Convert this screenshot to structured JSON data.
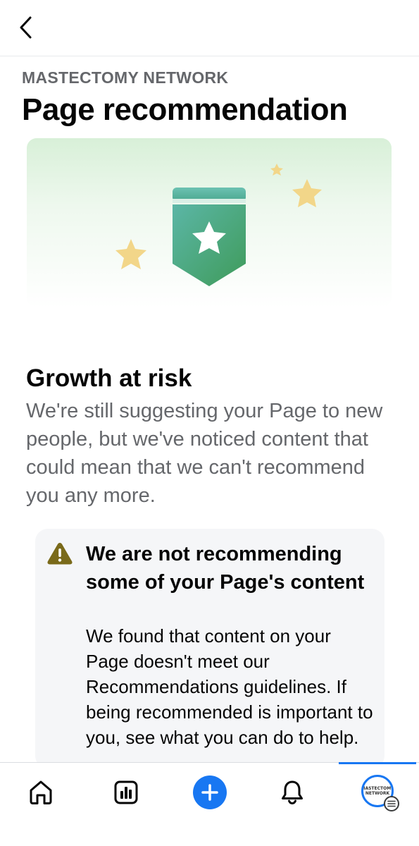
{
  "header": {
    "back_icon": "chevron-left-icon",
    "page_name": "MASTECTOMY NETWORK",
    "title": "Page recommendation"
  },
  "banner": {
    "icons": [
      "ribbon-star-icon",
      "star-icon",
      "star-icon",
      "star-icon"
    ],
    "colors": {
      "ribbon_top": "#5bb6a6",
      "ribbon_bottom": "#3f9b5a",
      "star": "#f2d689"
    }
  },
  "status": {
    "title": "Growth at risk",
    "description": "We're still suggesting your Page to new people, but we've noticed content that could mean that we can't recommend you any more."
  },
  "notice": {
    "icon": "warning-icon",
    "icon_color": "#7a6a1a",
    "title": "We are not recommending some of your Page's content",
    "body": "We found that content on your Page doesn't meet our Recommendations guidelines. If being recommended is important to you, see what you can do to help."
  },
  "tabbar": {
    "items": [
      {
        "icon": "home-icon"
      },
      {
        "icon": "insights-icon"
      },
      {
        "icon": "create-plus-icon"
      },
      {
        "icon": "bell-icon"
      },
      {
        "icon": "profile-menu-icon"
      }
    ],
    "avatar_text": "MASTECTOMY NETWORK",
    "accent": "#1877f2"
  }
}
